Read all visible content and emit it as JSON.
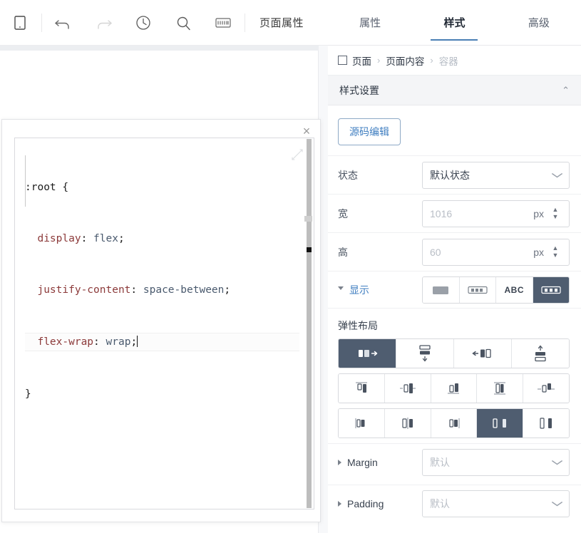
{
  "toolbar": {
    "icons": [
      {
        "name": "device-preview-icon",
        "glyph": "tablet"
      },
      {
        "name": "undo-icon",
        "glyph": "undo"
      },
      {
        "name": "redo-icon",
        "glyph": "redo",
        "disabled": true
      },
      {
        "name": "history-icon",
        "glyph": "clock"
      },
      {
        "name": "search-icon",
        "glyph": "magnifier"
      },
      {
        "name": "keyboard-shortcuts-icon",
        "glyph": "keyboard"
      }
    ],
    "page_properties_label": "页面属性"
  },
  "code_editor": {
    "close_label": "×",
    "lines": [
      {
        "selector": ":root {"
      },
      {
        "prop": "display",
        "value": "flex"
      },
      {
        "prop": "justify-content",
        "value": "space-between"
      },
      {
        "prop": "flex-wrap",
        "value": "wrap",
        "active": true
      },
      {
        "selector": "}"
      }
    ],
    "full_text": ":root {\n  display: flex;\n  justify-content: space-between;\n  flex-wrap: wrap;\n}"
  },
  "right_panel": {
    "tabs": [
      {
        "label": "属性",
        "active": false
      },
      {
        "label": "样式",
        "active": true
      },
      {
        "label": "高级",
        "active": false
      }
    ],
    "breadcrumb": [
      {
        "label": "页面",
        "muted": false
      },
      {
        "label": "页面内容",
        "muted": false
      },
      {
        "label": "容器",
        "muted": true
      }
    ],
    "breadcrumb_separator": "›",
    "section": {
      "title": "样式设置",
      "collapse_glyph": "⌃"
    },
    "source_edit_button": "源码编辑",
    "fields": {
      "state": {
        "label": "状态",
        "value": "默认状态",
        "placeholder": ""
      },
      "width": {
        "label": "宽",
        "value": "",
        "placeholder": "1016",
        "unit": "px"
      },
      "height": {
        "label": "高",
        "value": "",
        "placeholder": "60",
        "unit": "px"
      }
    },
    "display": {
      "label": "显示",
      "options": [
        {
          "name": "display-block",
          "selected": false
        },
        {
          "name": "display-inline-block",
          "selected": false
        },
        {
          "name": "display-inline",
          "label": "ABC",
          "selected": false
        },
        {
          "name": "display-flex",
          "selected": true
        }
      ]
    },
    "flex_layout": {
      "title": "弹性布局",
      "direction": [
        {
          "name": "flex-direction-row",
          "selected": true
        },
        {
          "name": "flex-direction-column",
          "selected": false
        },
        {
          "name": "flex-direction-row-reverse",
          "selected": false
        },
        {
          "name": "flex-direction-column-reverse",
          "selected": false
        }
      ],
      "align": [
        {
          "name": "align-items-flex-start",
          "selected": false
        },
        {
          "name": "align-items-center",
          "selected": false
        },
        {
          "name": "align-items-flex-end",
          "selected": false
        },
        {
          "name": "align-items-stretch",
          "selected": false
        },
        {
          "name": "align-items-baseline",
          "selected": false
        }
      ],
      "justify": [
        {
          "name": "justify-content-flex-start",
          "selected": false
        },
        {
          "name": "justify-content-center",
          "selected": false
        },
        {
          "name": "justify-content-flex-end",
          "selected": false
        },
        {
          "name": "justify-content-space-between",
          "selected": true
        },
        {
          "name": "justify-content-space-around",
          "selected": false
        }
      ]
    },
    "spacing": {
      "margin": {
        "label": "Margin",
        "placeholder": "默认"
      },
      "padding": {
        "label": "Padding",
        "placeholder": "默认"
      }
    }
  },
  "colors": {
    "accent_blue": "#3f7ec0",
    "tab_underline": "#4a7fb5",
    "selected_dark": "#4f5d70",
    "code_property": "#8c3a3a",
    "code_value": "#4a5a6e",
    "panel_header_bg": "#f4f5f7"
  }
}
